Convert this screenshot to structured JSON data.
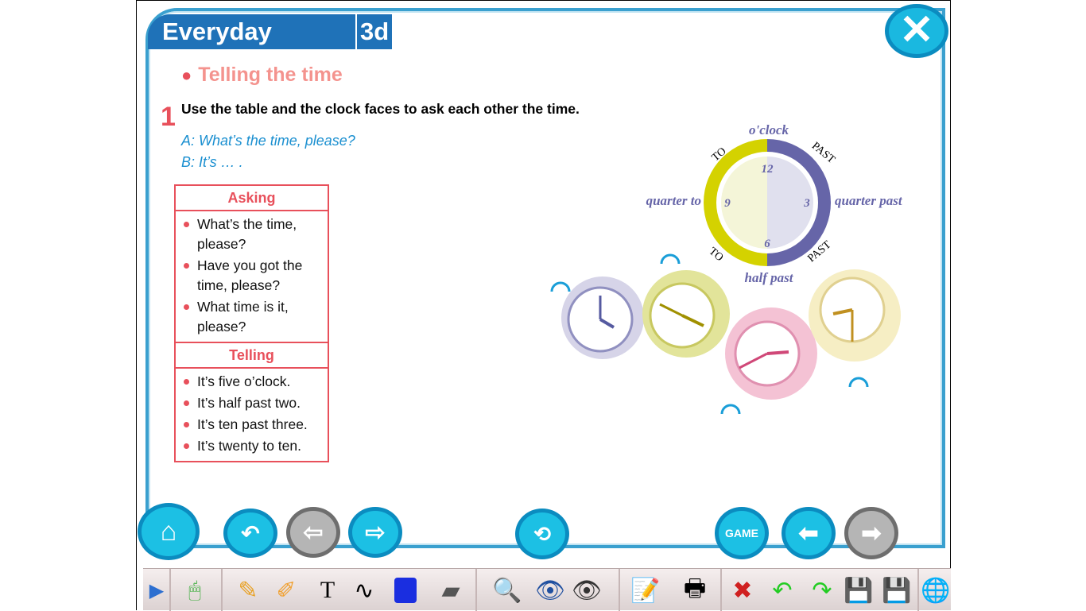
{
  "header": {
    "title": "Everyday English",
    "unit": "3d"
  },
  "section": {
    "title": "Telling the time"
  },
  "exercise": {
    "number": "1",
    "instruction": "Use the table and the clock faces to ask each other the time.",
    "dialogue": [
      "A:  What’s the time, please?",
      "B:  It’s … ."
    ]
  },
  "table": {
    "asking_header": "Asking",
    "asking": [
      "What’s the time, please?",
      "Have you got the time, please?",
      "What time is it, please?"
    ],
    "telling_header": "Telling",
    "telling": [
      "It’s five o’clock.",
      "It’s half past two.",
      "It’s ten past three.",
      "It’s twenty to ten."
    ]
  },
  "diagram": {
    "top": "o'clock",
    "left": "quarter to",
    "right": "quarter past",
    "bottom": "half past",
    "to": "TO",
    "past": "PAST",
    "numbers": [
      "12",
      "3",
      "6",
      "9"
    ]
  },
  "nav": {
    "game": "GAME"
  },
  "toolbar": {
    "text_tool": "T"
  },
  "colors": {
    "brand": "#1f72b8",
    "accent": "#e8505b",
    "dialogue": "#1a8fd0",
    "button": "#1cc0e4"
  }
}
